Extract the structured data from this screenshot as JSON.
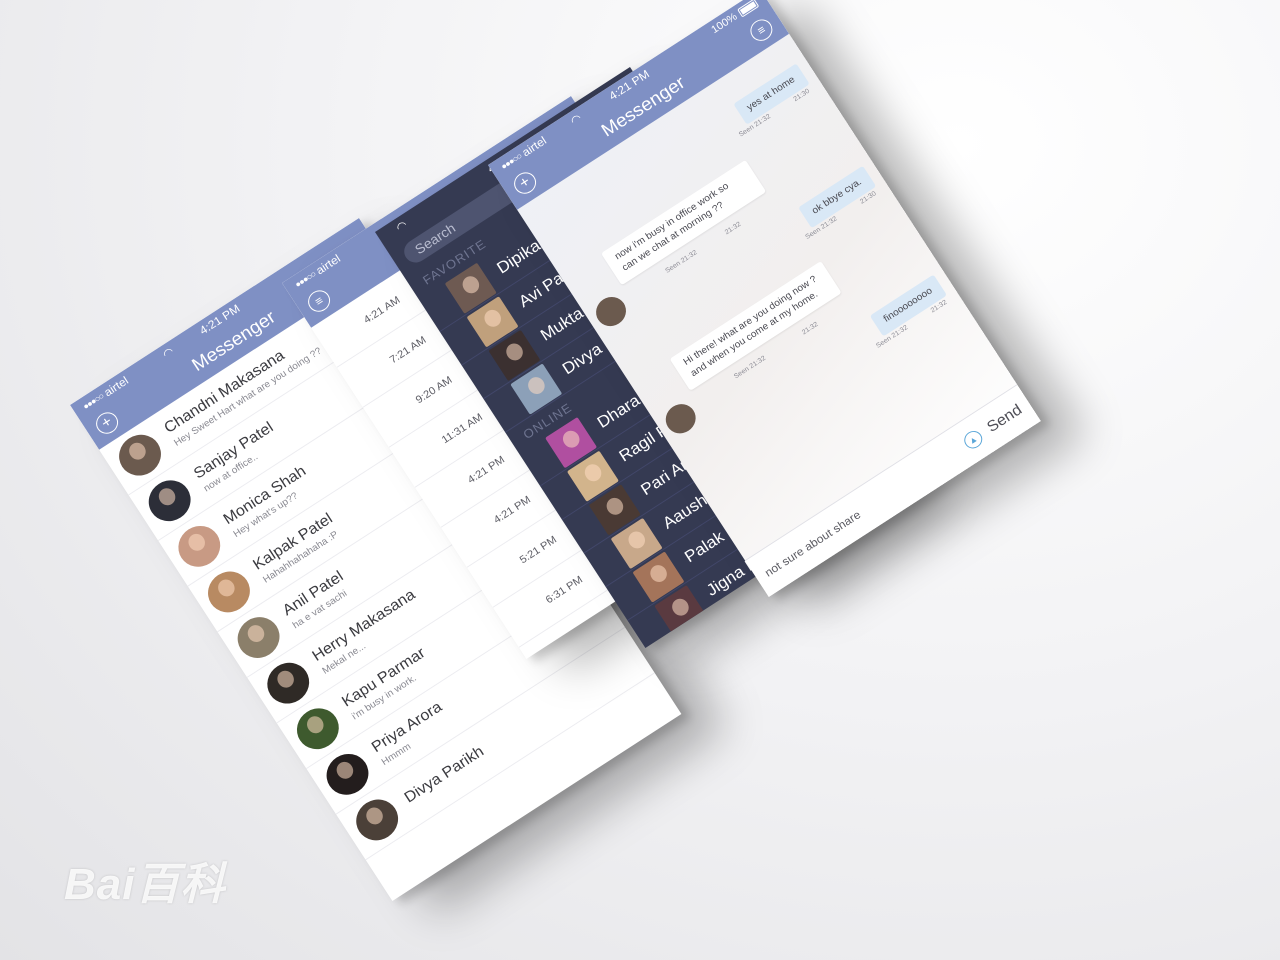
{
  "status": {
    "carrier": "airtel",
    "time": "4:21 PM",
    "battery": "100%"
  },
  "app_title": "Messenger",
  "chat_list": [
    {
      "name": "Chandni Makasana",
      "preview": "Hey Sweet Hart what are you doing ??",
      "color": "#6b5a4e"
    },
    {
      "name": "Sanjay Patel",
      "preview": "now at office..",
      "color": "#2c2e38"
    },
    {
      "name": "Monica Shah",
      "preview": "Hey what's up??",
      "color": "#c89a84"
    },
    {
      "name": "Kalpak Patel",
      "preview": "Hahahhahahaha :P",
      "color": "#b88a62"
    },
    {
      "name": "Anil Patel",
      "preview": "ha e vat sachi",
      "color": "#8b7f6a"
    },
    {
      "name": "Herry Makasana",
      "preview": "Mekal ne...",
      "color": "#2f2a26"
    },
    {
      "name": "Kapu Parmar",
      "preview": "i'm busy in work.",
      "color": "#3e5a2e"
    },
    {
      "name": "Priya Arora",
      "preview": "Hmmm",
      "color": "#231d1d"
    },
    {
      "name": "Divya Parikh",
      "preview": "",
      "color": "#4b4038"
    }
  ],
  "times": [
    "4:21 AM",
    "7:21 AM",
    "9:20 AM",
    "11:31 AM",
    "4:21 PM",
    "4:21 PM",
    "5:21 PM",
    "6:31 PM"
  ],
  "drawer": {
    "search_placeholder": "Search",
    "favorite_label": "FAVORITE",
    "online_label": "ONLINE",
    "favorites": [
      {
        "name": "Dipika Patel",
        "color": "#6e5a52"
      },
      {
        "name": "Avi Patel",
        "color": "#c0a07c"
      },
      {
        "name": "Mukta Shah",
        "color": "#3b3030"
      },
      {
        "name": "Divya Parmar",
        "color": "#8ca0b8"
      }
    ],
    "online": [
      {
        "name": "Dhara Matth",
        "color": "#b04fa0"
      },
      {
        "name": "Ragil Patel",
        "color": "#d2b48c"
      },
      {
        "name": "Pari Arrora",
        "color": "#4a3a34"
      },
      {
        "name": "Aaushi Patel",
        "color": "#c8a88a"
      },
      {
        "name": "Palak Shah",
        "color": "#a4745a"
      },
      {
        "name": "Jigna Patel",
        "color": "#5a3a40"
      }
    ]
  },
  "conversation": {
    "messages": [
      {
        "dir": "out",
        "text": "yes at home",
        "time": "21:30",
        "seen": "Seen 21:32"
      },
      {
        "dir": "in",
        "text": "now i'm busy in office work so can we chat at morning ??",
        "time": "21:32",
        "seen": "Seen 21:32"
      },
      {
        "dir": "out",
        "text": "ok bbye cya.",
        "time": "21:30",
        "seen": "Seen 21:32"
      },
      {
        "dir": "in",
        "text": "Hi there! what are you doing now ? and when you come at my home.",
        "time": "21:32",
        "seen": "Seen 21:32"
      },
      {
        "dir": "out",
        "text": "finoooooooo",
        "time": "21:32",
        "seen": "Seen 21:32"
      }
    ],
    "draft": "not sure about share",
    "send_label": "Send"
  },
  "watermark": "Bai百科"
}
